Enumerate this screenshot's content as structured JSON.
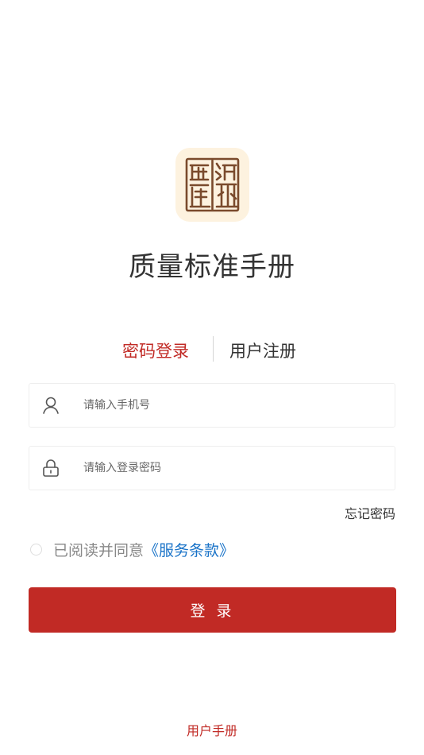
{
  "app": {
    "title": "质量标准手册",
    "logo_icon": "seal-stamp-logo"
  },
  "tabs": [
    {
      "label": "密码登录",
      "active": true
    },
    {
      "label": "用户注册",
      "active": false
    }
  ],
  "form": {
    "phone": {
      "placeholder": "请输入手机号",
      "value": "",
      "icon": "user-icon"
    },
    "password": {
      "placeholder": "请输入登录密码",
      "value": "",
      "icon": "lock-icon"
    }
  },
  "forgot_label": "忘记密码",
  "agreement": {
    "checked": false,
    "text": "已阅读并同意",
    "link": "《服务条款》"
  },
  "login_button": "登 录",
  "manual_link": "用户手册",
  "colors": {
    "accent": "#c12a25",
    "link": "#1a73c8",
    "logo_bg": "#fdf2df",
    "seal_ink": "#7a4a2c"
  }
}
